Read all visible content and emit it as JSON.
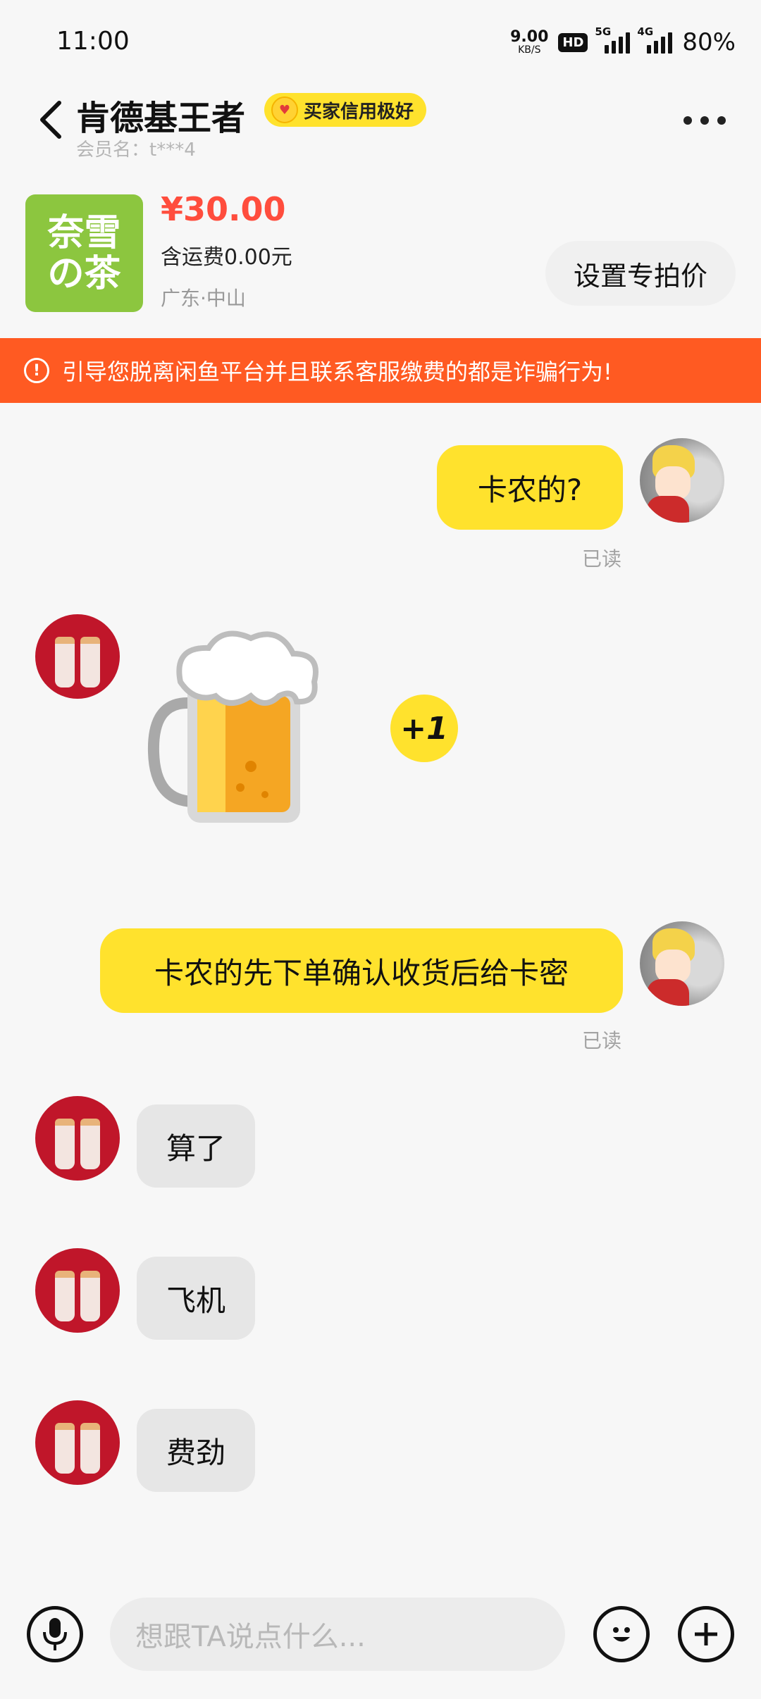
{
  "status_bar": {
    "time": "11:00",
    "net_speed_value": "9.00",
    "net_speed_unit": "KB/S",
    "hd_badge": "HD",
    "sig1_label": "5G",
    "sig2_label": "4G",
    "battery": "80%"
  },
  "header": {
    "title": "肯德基王者",
    "credit_badge": "买家信用极好",
    "member_name": "会员名：t***4"
  },
  "product": {
    "thumb_text_line1": "奈雪",
    "thumb_text_line2": "の茶",
    "price": "¥30.00",
    "shipping": "含运费0.00元",
    "location": "广东·中山",
    "special_price_button": "设置专拍价"
  },
  "warning": {
    "text": "引导您脱离闲鱼平台并且联系客服缴费的都是诈骗行为!"
  },
  "messages": [
    {
      "from": "me",
      "text": "卡农的?",
      "status": "已读"
    },
    {
      "from": "other",
      "type": "sticker",
      "sticker_name": "beer-mug",
      "badge": "+1"
    },
    {
      "from": "me",
      "text": "卡农的先下单确认收货后给卡密",
      "status": "已读"
    },
    {
      "from": "other",
      "text": "算了"
    },
    {
      "from": "other",
      "text": "飞机"
    },
    {
      "from": "other",
      "text": "费劲"
    }
  ],
  "input": {
    "placeholder": "想跟TA说点什么..."
  },
  "colors": {
    "accent_yellow": "#ffe22d",
    "warning_orange": "#ff5a22",
    "price_red": "#ff4d3d"
  },
  "icons": [
    "chevron-left-icon",
    "more-icon",
    "mic-icon",
    "emoji-icon",
    "plus-icon",
    "warning-icon"
  ]
}
